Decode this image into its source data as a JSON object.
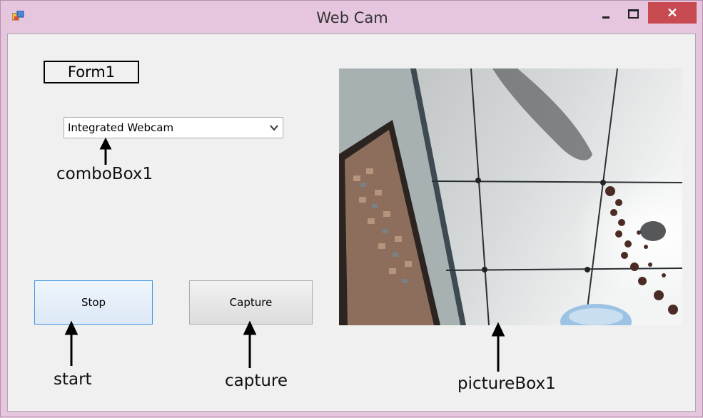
{
  "window": {
    "title": "Web Cam",
    "close_label": "✕"
  },
  "form": {
    "label": "Form1"
  },
  "combo": {
    "selected": "Integrated Webcam"
  },
  "buttons": {
    "stop": "Stop",
    "capture": "Capture"
  },
  "annotations": {
    "combo": "comboBox1",
    "start": "start",
    "capture": "capture",
    "picture": "pictureBox1"
  },
  "icons": [
    "app-icon",
    "minimize-icon",
    "maximize-icon",
    "close-icon",
    "chevron-down-icon"
  ],
  "colors": {
    "titlebar": "#e6c6df",
    "close": "#c74b50",
    "focus_border": "#3c97e8",
    "client": "#f0f0f0"
  }
}
